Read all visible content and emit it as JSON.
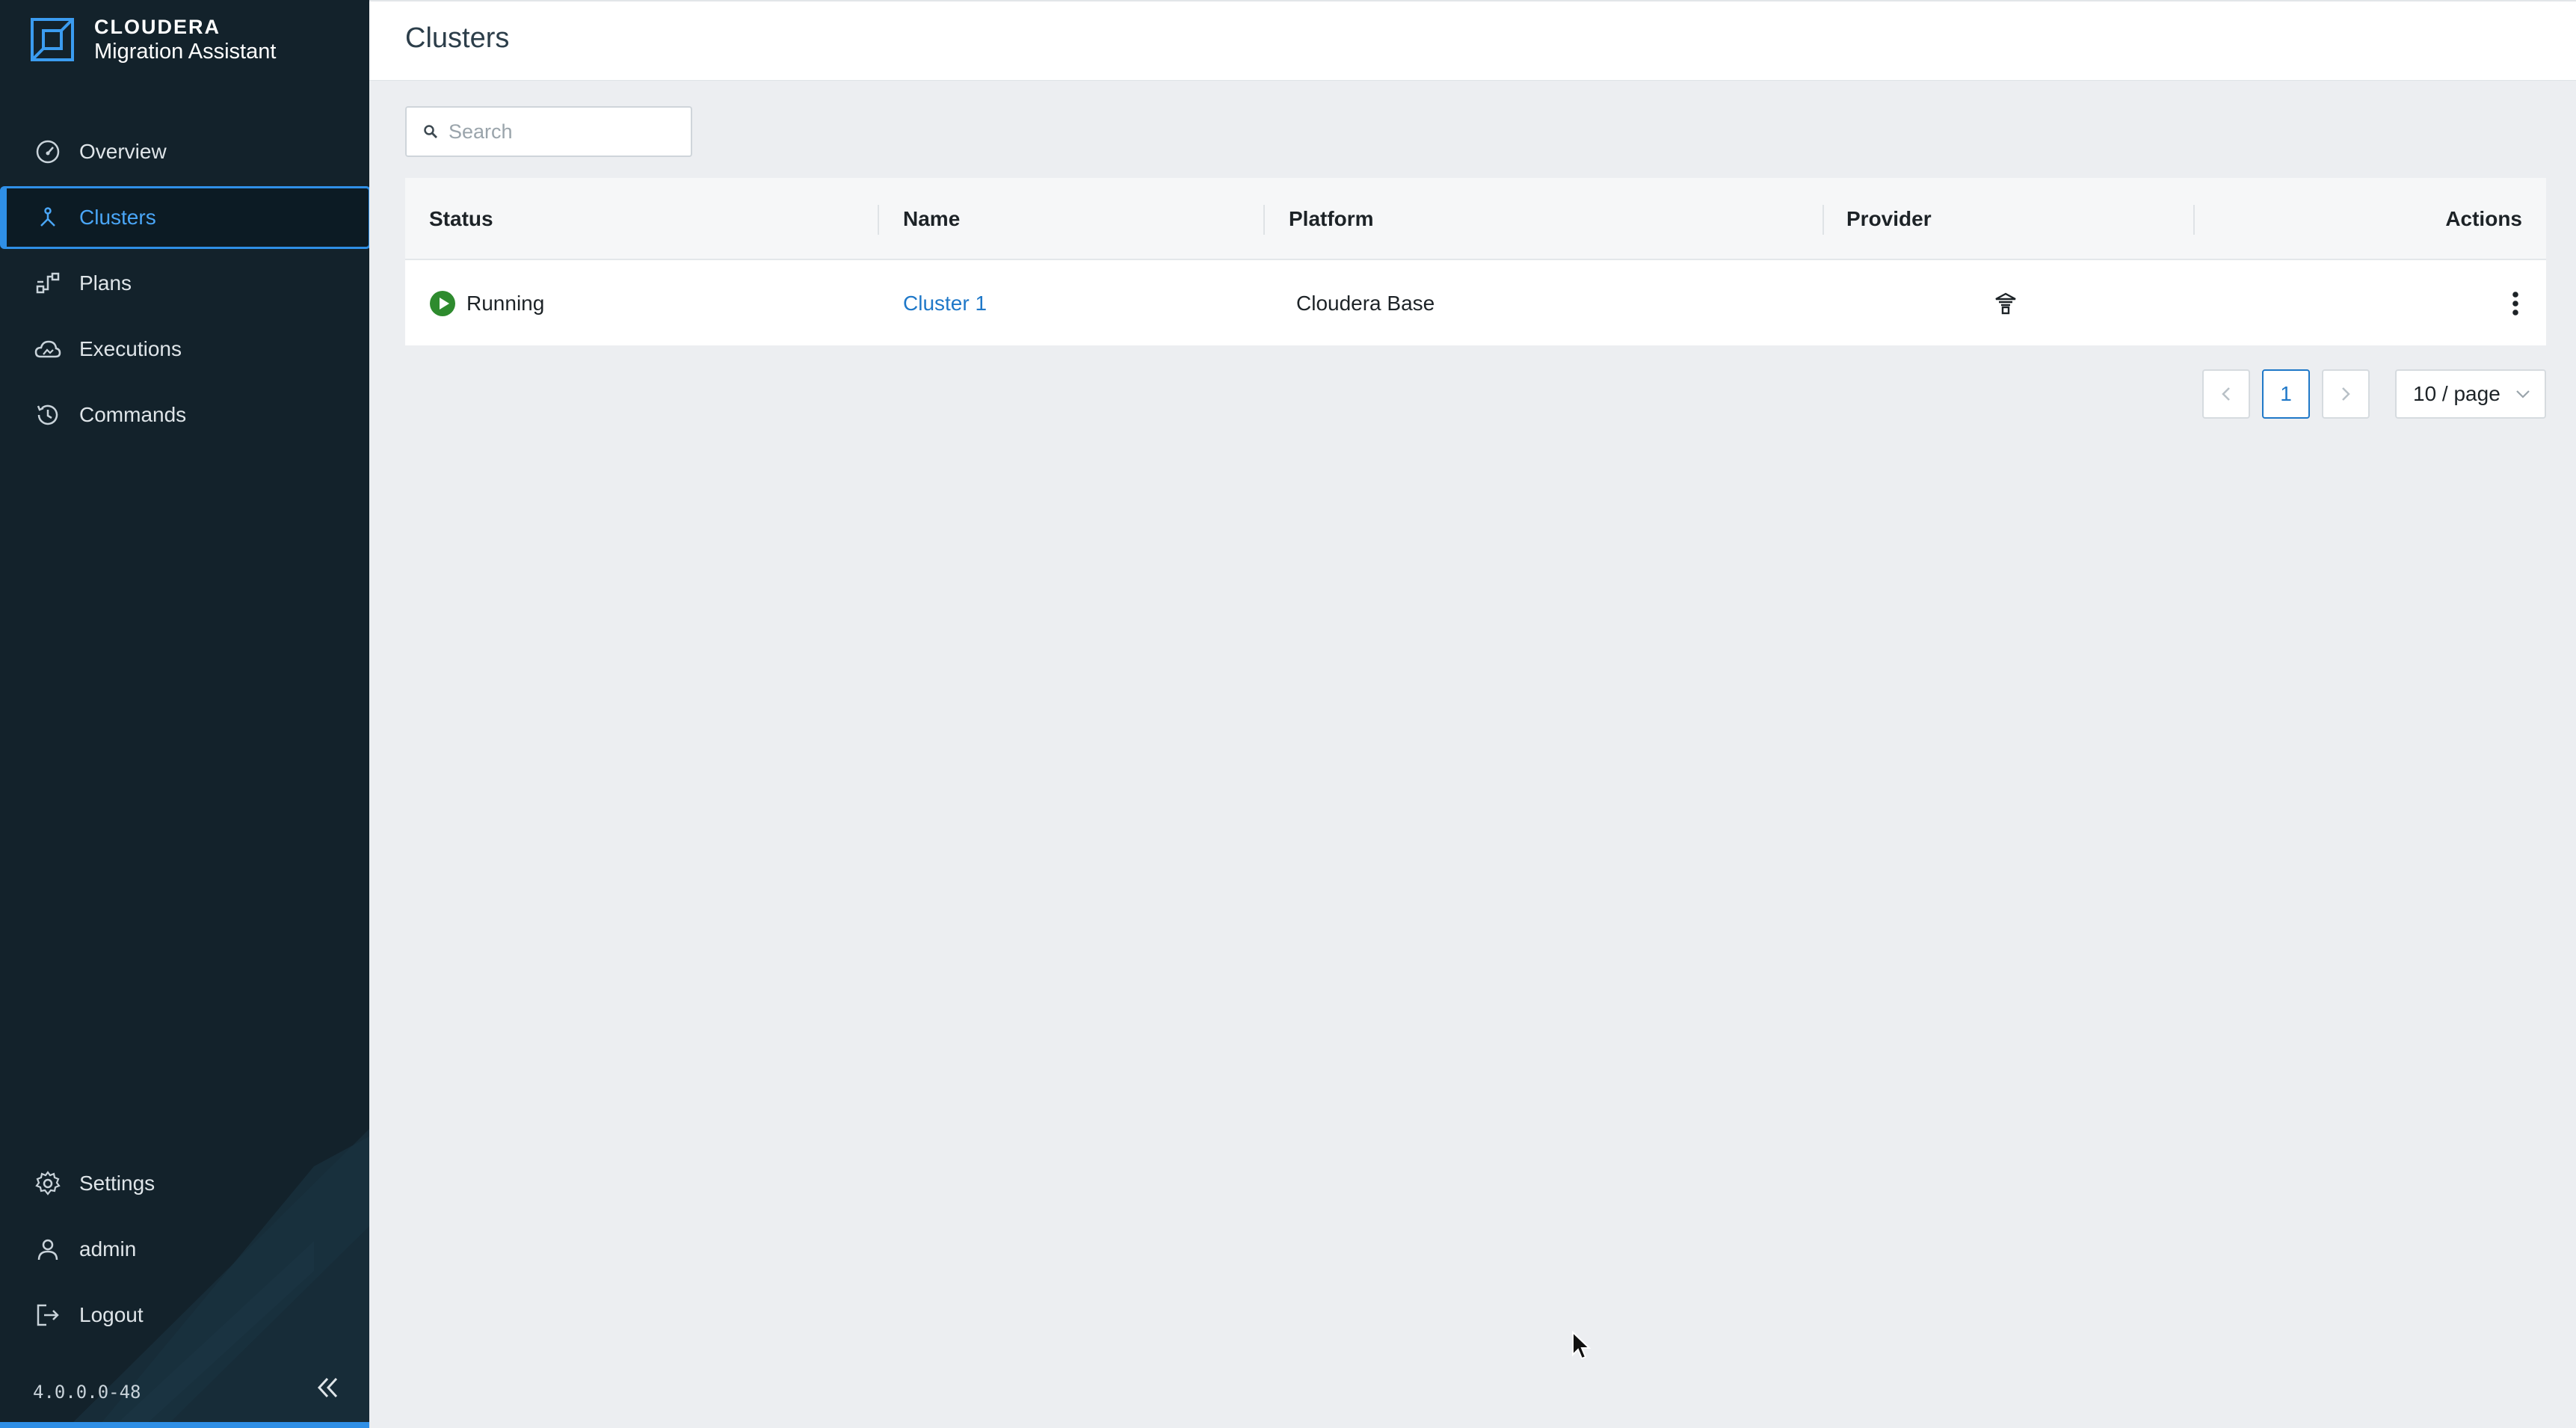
{
  "app": {
    "company": "CLOUDERA",
    "product": "Migration Assistant",
    "version": "4.0.0.0-48",
    "accent_color": "#2f8fe6"
  },
  "sidebar": {
    "items": [
      {
        "label": "Overview",
        "icon": "gauge-icon",
        "active": false
      },
      {
        "label": "Clusters",
        "icon": "cluster-icon",
        "active": true
      },
      {
        "label": "Plans",
        "icon": "plans-icon",
        "active": false
      },
      {
        "label": "Executions",
        "icon": "cloud-icon",
        "active": false
      },
      {
        "label": "Commands",
        "icon": "history-icon",
        "active": false
      }
    ],
    "bottom_items": [
      {
        "label": "Settings",
        "icon": "gear-icon"
      },
      {
        "label": "admin",
        "icon": "user-icon"
      },
      {
        "label": "Logout",
        "icon": "logout-icon"
      }
    ],
    "collapse_icon": "double-chevron-left-icon"
  },
  "header": {
    "title": "Clusters"
  },
  "search": {
    "placeholder": "Search",
    "value": ""
  },
  "table": {
    "columns": [
      "Status",
      "Name",
      "Platform",
      "Provider",
      "Actions"
    ],
    "rows": [
      {
        "status": "Running",
        "status_color": "#2e8b2e",
        "name": "Cluster 1",
        "platform": "Cloudera Base",
        "provider_icon": "on-premise-icon",
        "actions_icon": "kebab-menu-icon"
      }
    ]
  },
  "pagination": {
    "prev": "<",
    "current_page": "1",
    "next": ">",
    "page_size": "10 / page"
  }
}
